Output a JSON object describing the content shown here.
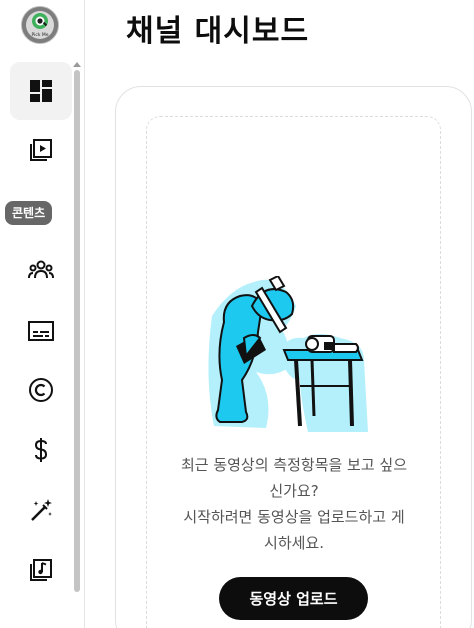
{
  "sidebar": {
    "avatar_text": "Pick Me",
    "tooltip": "콘텐츠",
    "items": [
      {
        "name": "dashboard",
        "icon": "dashboard-icon",
        "active": true
      },
      {
        "name": "content",
        "icon": "video-library-icon",
        "active": false
      },
      {
        "name": "community",
        "icon": "people-icon",
        "active": false
      },
      {
        "name": "subtitles",
        "icon": "subtitles-icon",
        "active": false
      },
      {
        "name": "copyright",
        "icon": "copyright-icon",
        "active": false
      },
      {
        "name": "earn",
        "icon": "dollar-icon",
        "active": false
      },
      {
        "name": "customization",
        "icon": "magic-wand-icon",
        "active": false
      },
      {
        "name": "audio-library",
        "icon": "audio-library-icon",
        "active": false
      }
    ]
  },
  "main": {
    "title": "채널 대시보드",
    "empty_state": {
      "line1": "최근 동영상의 측정항목을 보고 싶으",
      "line2": "신가요?",
      "line3": "시작하려면 동영상을 업로드하고 게",
      "line4": "시하세요.",
      "button_label": "동영상 업로드"
    }
  },
  "colors": {
    "accent_cyan": "#1ec9f0",
    "illustration_glow": "#b3f0fb",
    "button_bg": "#0d0d0d",
    "tooltip_bg": "#676767"
  }
}
